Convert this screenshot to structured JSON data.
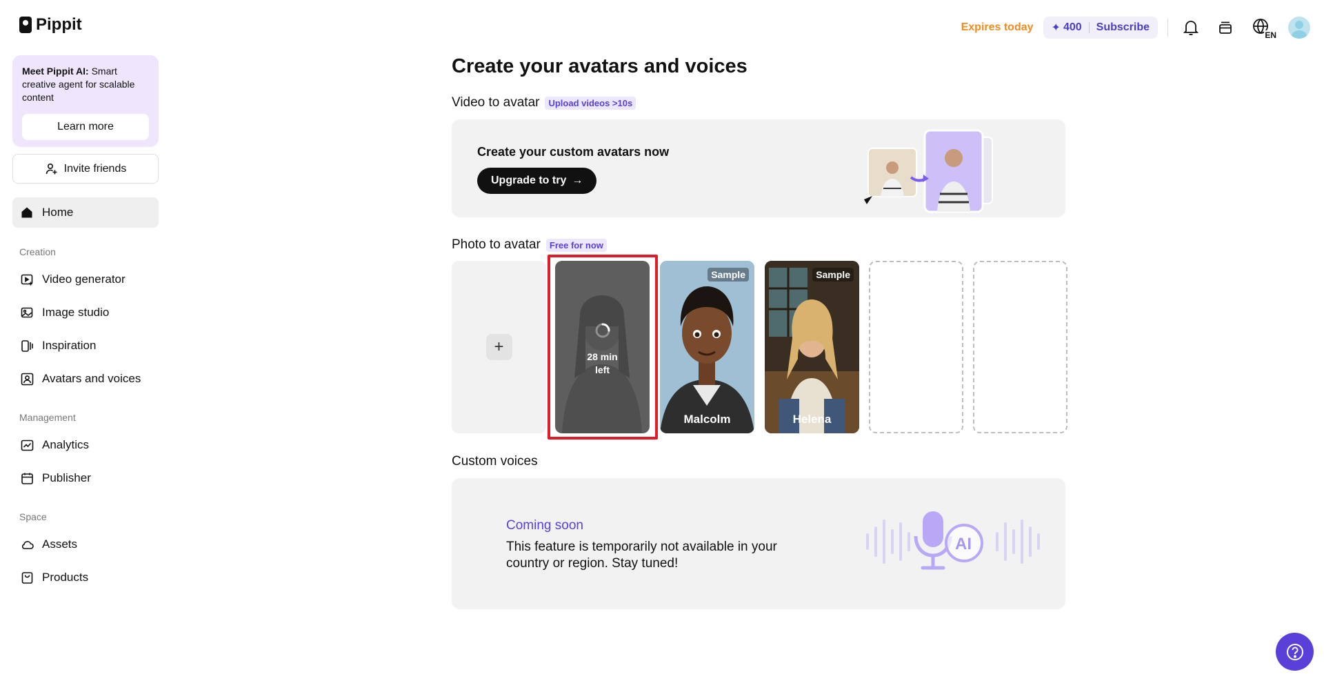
{
  "app": {
    "name": "Pippit"
  },
  "sidebar": {
    "promo": {
      "bold": "Meet Pippit AI:",
      "text": " Smart creative agent for scalable content",
      "button": "Learn more"
    },
    "invite": "Invite friends",
    "home": "Home",
    "sections": {
      "creation": "Creation",
      "management": "Management",
      "space": "Space"
    },
    "items": {
      "video_generator": "Video generator",
      "image_studio": "Image studio",
      "inspiration": "Inspiration",
      "avatars_voices": "Avatars and voices",
      "analytics": "Analytics",
      "publisher": "Publisher",
      "assets": "Assets",
      "products": "Products"
    }
  },
  "header": {
    "expires": "Expires today",
    "credits": "400",
    "subscribe": "Subscribe",
    "language": "EN"
  },
  "main": {
    "title": "Create your avatars and voices",
    "video_to_avatar": {
      "label": "Video to avatar",
      "tag": "Upload videos >10s",
      "card_title": "Create your custom avatars now",
      "button": "Upgrade to try"
    },
    "photo_to_avatar": {
      "label": "Photo to avatar",
      "tag": "Free for now",
      "loading": {
        "line1": "28 min",
        "line2": "left"
      },
      "samples": [
        {
          "badge": "Sample",
          "name": "Malcolm"
        },
        {
          "badge": "Sample",
          "name": "Helena"
        }
      ]
    },
    "custom_voices": {
      "label": "Custom voices",
      "status": "Coming soon",
      "description": "This feature is temporarily not available in your country or region. Stay tuned!"
    }
  },
  "colors": {
    "accent": "#5b3fd9",
    "expires": "#f08c1f",
    "highlight": "#e01b2a"
  }
}
